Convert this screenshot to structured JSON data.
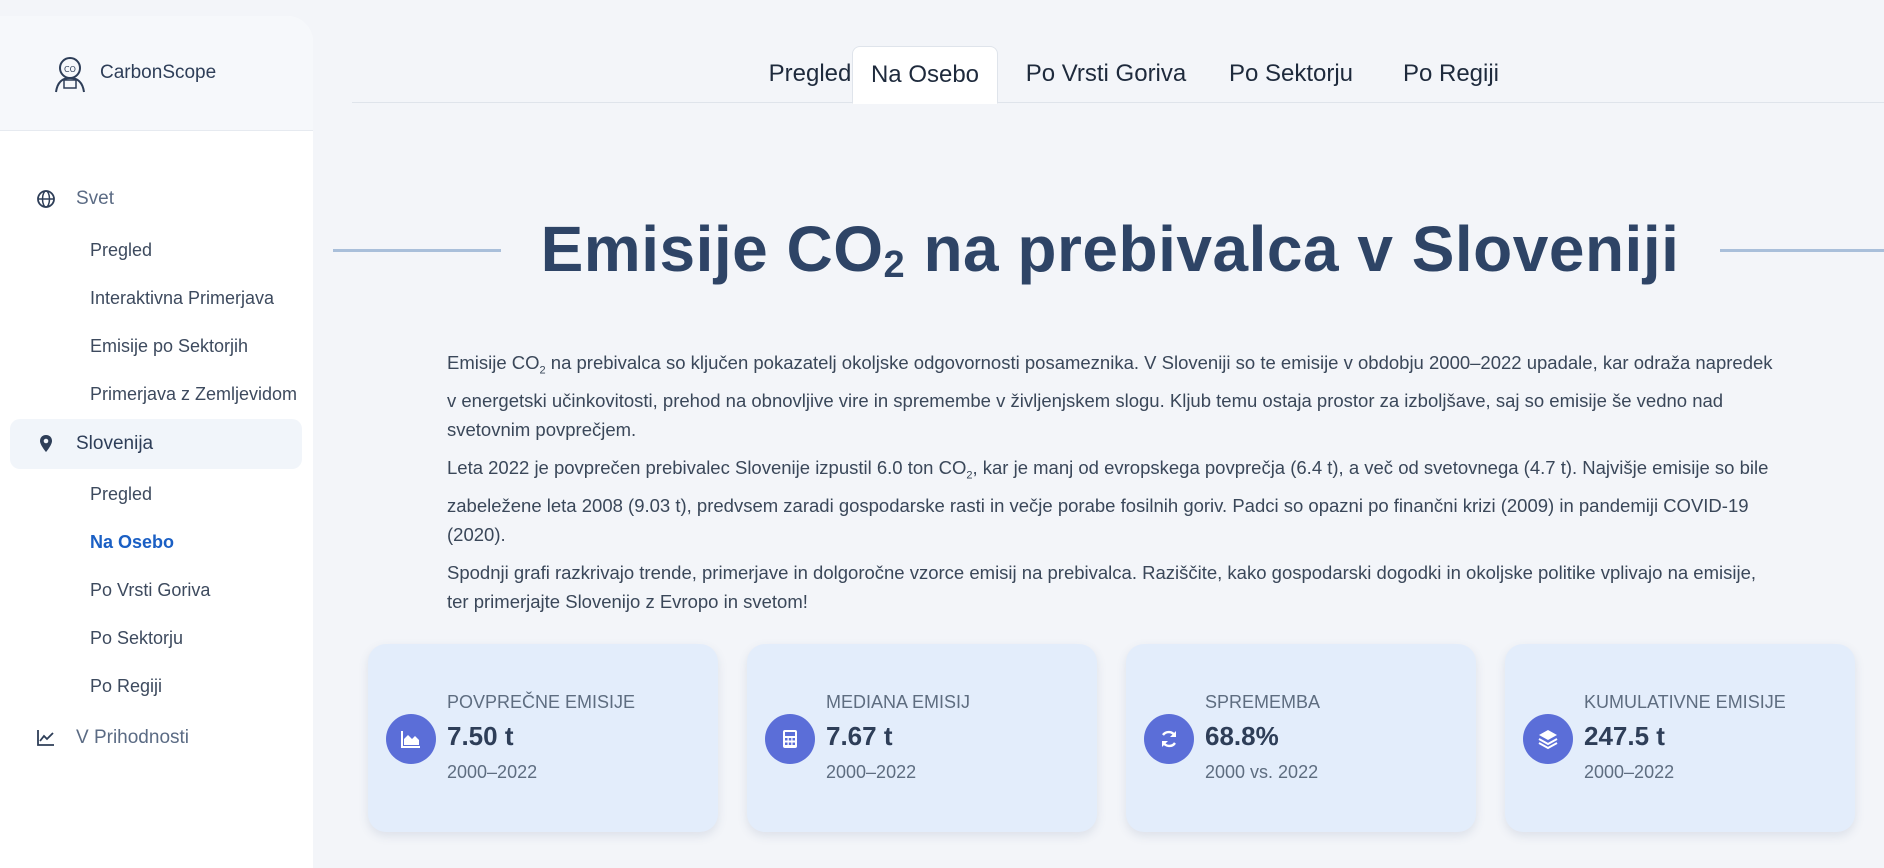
{
  "app": {
    "name": "CarbonScope"
  },
  "sidebar": {
    "sections": [
      {
        "label": "Svet",
        "icon": "globe-icon"
      },
      {
        "label": "Slovenija",
        "icon": "location-pin-icon"
      },
      {
        "label": "V Prihodnosti",
        "icon": "trend-chart-icon"
      }
    ],
    "svet_items": [
      "Pregled",
      "Interaktivna Primerjava",
      "Emisije po Sektorjih",
      "Primerjava z Zemljevidom"
    ],
    "slovenija_items": [
      "Pregled",
      "Na Osebo",
      "Po Vrsti Goriva",
      "Po Sektorju",
      "Po Regiji"
    ]
  },
  "tabs": [
    "Pregled",
    "Na Osebo",
    "Po Vrsti Goriva",
    "Po Sektorju",
    "Po Regiji"
  ],
  "page": {
    "title_pre": "Emisije CO",
    "title_sub": "2",
    "title_post": " na prebivalca v Sloveniji",
    "para1_a": "Emisije CO",
    "para1_sub": "2",
    "para1_b": " na prebivalca so ključen pokazatelj okoljske odgovornosti posameznika. V Sloveniji so te emisije v obdobju 2000–2022 upadale, kar odraža napredek v energetski učinkovitosti, prehod na obnovljive vire in spremembe v življenjskem slogu. Kljub temu ostaja prostor za izboljšave, saj so emisije še vedno nad svetovnim povprečjem.",
    "para2_a": "Leta 2022 je povprečen prebivalec Slovenije izpustil 6.0 ton CO",
    "para2_sub": "2",
    "para2_b": ", kar je manj od evropskega povprečja (6.4 t), a več od svetovnega (4.7 t). Najvišje emisije so bile zabeležene leta 2008 (9.03 t), predvsem zaradi gospodarske rasti in večje porabe fosilnih goriv. Padci so opazni po finančni krizi (2009) in pandemiji COVID-19 (2020).",
    "para3": "Spodnji grafi razkrivajo trende, primerjave in dolgoročne vzorce emisij na prebivalca. Raziščite, kako gospodarski dogodki in okoljske politike vplivajo na emisije, ter primerjajte Slovenijo z Evropo in svetom!"
  },
  "cards": [
    {
      "label": "POVPREČNE EMISIJE",
      "value": "7.50 t",
      "sub": "2000–2022",
      "icon": "area-chart-icon"
    },
    {
      "label": "MEDIANA EMISIJ",
      "value": "7.67 t",
      "sub": "2000–2022",
      "icon": "calculator-icon"
    },
    {
      "label": "SPREMEMBA",
      "value": "68.8%",
      "sub": "2000 vs. 2022",
      "icon": "refresh-icon"
    },
    {
      "label": "KUMULATIVNE EMISIJE",
      "value": "247.5 t",
      "sub": "2000–2022",
      "icon": "layers-icon"
    }
  ],
  "colors": {
    "accent": "#1a5fc4",
    "badge": "#5b6ed8",
    "card_bg": "#e3edfb",
    "title": "#2e4466"
  }
}
